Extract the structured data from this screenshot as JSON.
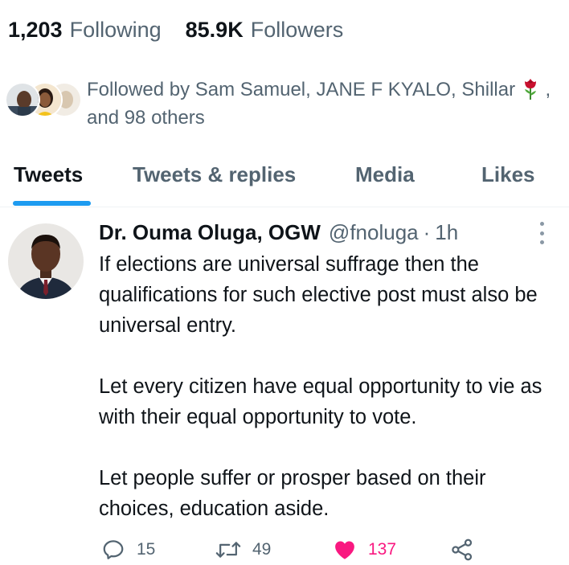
{
  "stats": {
    "following_count": "1,203",
    "following_label": "Following",
    "followers_count": "85.9K",
    "followers_label": "Followers"
  },
  "followed_by": {
    "text": "Followed by Sam Samuel, JANE F KYALO, Shillar",
    "suffix": ",",
    "others": "and 98 others",
    "emoji_icon": "rose-icon"
  },
  "tabs": [
    {
      "label": "Tweets",
      "active": true
    },
    {
      "label": "Tweets & replies",
      "active": false
    },
    {
      "label": "Media",
      "active": false
    },
    {
      "label": "Likes",
      "active": false
    }
  ],
  "tweet": {
    "author_name": "Dr. Ouma Oluga, OGW",
    "handle": "@fnoluga",
    "separator": "·",
    "time": "1h",
    "paragraphs": [
      "If elections are universal suffrage then the qualifications for such elective post must also be universal entry.",
      "Let every citizen have equal opportunity to vie as with their equal opportunity to vote.",
      "Let people suffer or prosper based on their choices, education aside."
    ],
    "replies": "15",
    "retweets": "49",
    "likes": "137",
    "liked": true
  },
  "colors": {
    "accent": "#1d9bf0",
    "secondary_text": "#536471",
    "like": "#f91880",
    "primary_text": "#0f1419"
  }
}
